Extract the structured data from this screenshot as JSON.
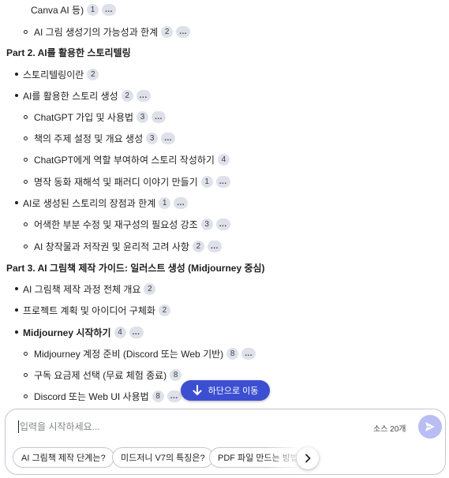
{
  "doc": {
    "items": [
      {
        "kind": "b2cont",
        "text": "Canva AI 등)",
        "chips": [
          "1",
          "..."
        ]
      },
      {
        "kind": "b2",
        "text": "AI 그림 생성기의 가능성과 한계",
        "chips": [
          "2",
          "..."
        ]
      },
      {
        "kind": "h",
        "text": "Part 2. AI를 활용한 스토리텔링",
        "chips": []
      },
      {
        "kind": "b1",
        "text": "스토리텔링이란",
        "chips": [
          "2"
        ]
      },
      {
        "kind": "b1",
        "text": "AI를 활용한 스토리 생성",
        "chips": [
          "2",
          "..."
        ]
      },
      {
        "kind": "b2",
        "text": "ChatGPT 가입 및 사용법",
        "chips": [
          "3",
          "..."
        ]
      },
      {
        "kind": "b2",
        "text": "책의 주제 설정 및 개요 생성",
        "chips": [
          "3",
          "..."
        ]
      },
      {
        "kind": "b2",
        "text": "ChatGPT에게 역할 부여하여 스토리 작성하기",
        "chips": [
          "4"
        ]
      },
      {
        "kind": "b2",
        "text": "명작 동화 재해석 및 패러디 이야기 만들기",
        "chips": [
          "1",
          "..."
        ]
      },
      {
        "kind": "b1",
        "text": "AI로 생성된 스토리의 장점과 한계",
        "chips": [
          "1",
          "..."
        ]
      },
      {
        "kind": "b2",
        "text": "어색한 부분 수정 및 재구성의 필요성 강조",
        "chips": [
          "3",
          "..."
        ]
      },
      {
        "kind": "b2",
        "text": "AI 창작물과 저작권 및 윤리적 고려 사항",
        "chips": [
          "2",
          "..."
        ]
      },
      {
        "kind": "h",
        "text": "Part 3. AI 그림책 제작 가이드: 일러스트 생성 (Midjourney 중심)",
        "chips": []
      },
      {
        "kind": "b1",
        "text": "AI 그림책 제작 과정 전체 개요",
        "chips": [
          "2"
        ]
      },
      {
        "kind": "b1",
        "text": "프로젝트 계획 및 아이디어 구체화",
        "chips": [
          "2"
        ]
      },
      {
        "kind": "b1bold",
        "text": "Midjourney 시작하기",
        "chips": [
          "4",
          "..."
        ]
      },
      {
        "kind": "b2",
        "text": "Midjourney 계정 준비 (Discord 또는 Web 기반)",
        "chips": [
          "8",
          "..."
        ]
      },
      {
        "kind": "b2",
        "text": "구독 요금제 선택 (무료 체험 종료)",
        "chips": [
          "8"
        ]
      },
      {
        "kind": "b2",
        "text": "Discord 또는 Web UI 사용법",
        "chips": [
          "8",
          "..."
        ]
      }
    ]
  },
  "jump_button": {
    "label": "하단으로 이동",
    "icon": "arrow-down-icon"
  },
  "composer": {
    "placeholder": "입력을 시작하세요...",
    "source_count": "소스 20개",
    "send_icon": "send-icon"
  },
  "suggestions": [
    {
      "label": "AI 그림책 제작 단계는?"
    },
    {
      "label": "미드저니 V7의 특징은?"
    },
    {
      "label": "PDF 파일 만드는 방법"
    }
  ],
  "next_icon": "chevron-right-icon",
  "colors": {
    "accent": "#3d4fd1",
    "chip": "#dfe1ea",
    "send": "#b9bdf4"
  }
}
